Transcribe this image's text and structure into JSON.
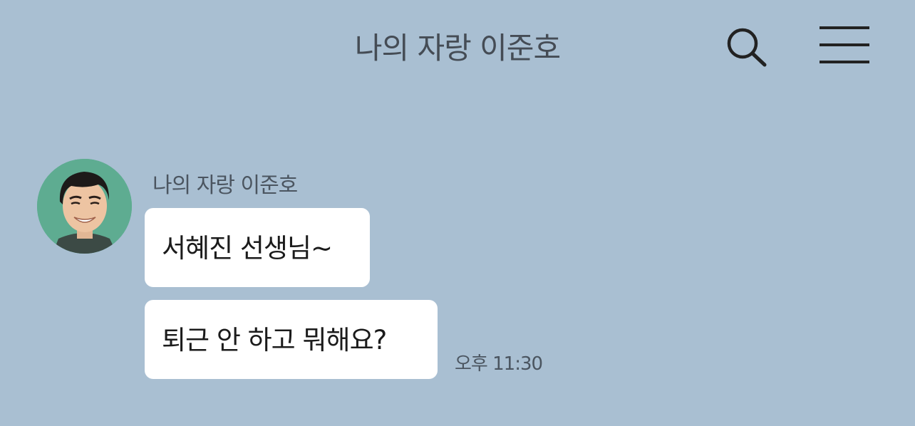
{
  "header": {
    "title": "나의 자랑 이준호",
    "search_icon": "search-icon",
    "menu_icon": "hamburger-menu-icon"
  },
  "colors": {
    "background": "#a9bfd2",
    "bubble": "#ffffff",
    "title_text": "#454c55",
    "meta_text": "#4b5560"
  },
  "chat": {
    "sender": {
      "name": "나의 자랑 이준호",
      "avatar_icon": "profile-photo-avatar"
    },
    "messages": [
      {
        "text": "서혜진 선생님~"
      },
      {
        "text": "퇴근 안 하고 뭐해요?",
        "time": "오후 11:30"
      }
    ]
  }
}
